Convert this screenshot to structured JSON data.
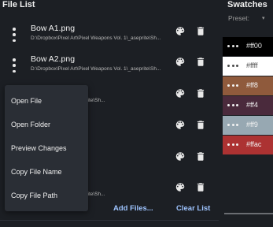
{
  "file_list": {
    "title": "File List",
    "files": [
      {
        "name": "Bow A1.png",
        "path": "D:\\Dropbox\\Pixel Art\\Pixel Weapons Vol. 1\\_aseprite\\Sh..."
      },
      {
        "name": "Bow A2.png",
        "path": "D:\\Dropbox\\Pixel Art\\Pixel Weapons Vol. 1\\_aseprite\\Sh..."
      },
      {
        "name": "",
        "path": "...Weapons Vol. 1\\_aseprite\\Sh..."
      },
      {
        "name": "",
        "path": ""
      },
      {
        "name": "",
        "path": ""
      },
      {
        "name": "",
        "path": "...Weapons Vol. 1\\_aseprite\\Sh..."
      }
    ],
    "add_files_label": "Add Files...",
    "clear_list_label": "Clear List"
  },
  "context_menu": {
    "items": [
      "Open File",
      "Open Folder",
      "Preview Changes",
      "Copy File Name",
      "Copy File Path"
    ]
  },
  "swatches": {
    "title": "Swatches",
    "preset_label": "Preset:",
    "items": [
      {
        "hex": "#ff00",
        "color": "#000000",
        "text_color": "#e8e8e8"
      },
      {
        "hex": "#ffff",
        "color": "#ffffff",
        "text_color": "#4a4a4a"
      },
      {
        "hex": "#ff8",
        "color": "#8f5a3c",
        "text_color": "#f2f2f2"
      },
      {
        "hex": "#ff4",
        "color": "#4a2a3c",
        "text_color": "#f2f2f2"
      },
      {
        "hex": "#ff9",
        "color": "#97a8b2",
        "text_color": "#f2f2f2"
      },
      {
        "hex": "#ffac",
        "color": "#ac3232",
        "text_color": "#f2f2f2"
      }
    ]
  },
  "icons": {
    "kebab": "more-vert-icon",
    "palette": "palette-icon",
    "trash": "trash-icon"
  }
}
